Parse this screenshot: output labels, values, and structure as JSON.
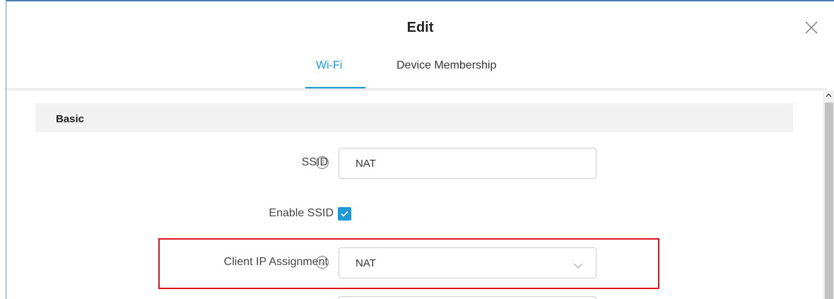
{
  "dialog": {
    "title": "Edit"
  },
  "tabs": [
    {
      "label": "Wi-Fi",
      "active": true
    },
    {
      "label": "Device Membership",
      "active": false
    }
  ],
  "section": {
    "title": "Basic"
  },
  "fields": {
    "ssid": {
      "label": "SSID",
      "value": "NAT"
    },
    "enable_ssid": {
      "label": "Enable SSID",
      "checked": true
    },
    "client_ip": {
      "label": "Client IP Assignment",
      "value": "NAT"
    }
  },
  "colors": {
    "accent": "#1e9ad6",
    "highlight": "#e0141e"
  },
  "icons": [
    "close-icon",
    "help-icon",
    "checkmark-icon",
    "chevron-down-icon",
    "scroll-up-icon"
  ]
}
